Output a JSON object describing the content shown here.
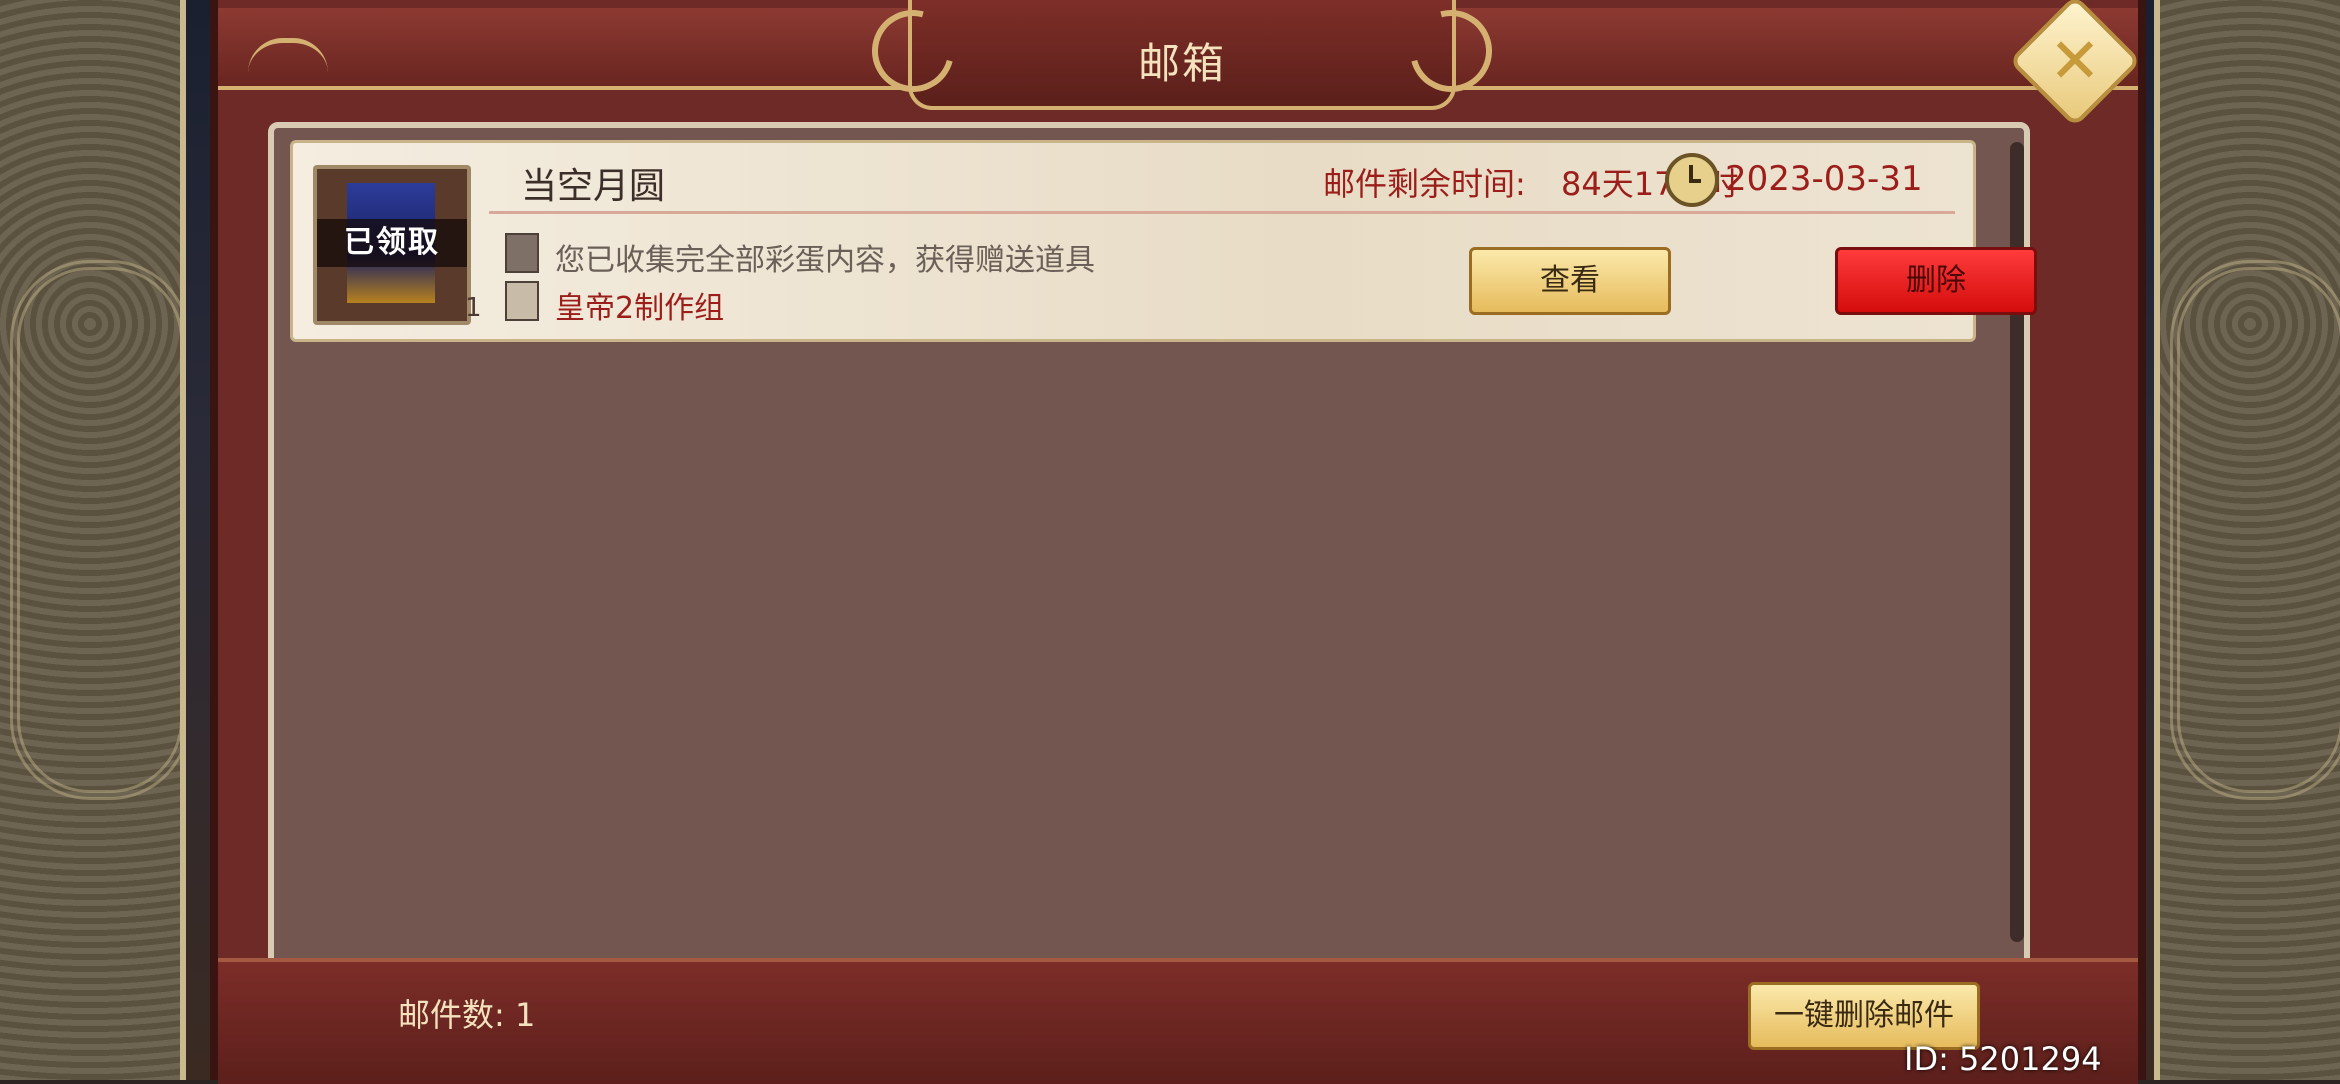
{
  "window": {
    "title": "邮箱"
  },
  "mail_items": [
    {
      "title": "当空月圆",
      "status_badge": "已领取",
      "quantity": "1",
      "expire_label": "邮件剩余时间:",
      "expire_value": "84天17小时",
      "date": "2023-03-31",
      "description": "您已收集完全部彩蛋内容，获得赠送道具",
      "sender": "皇帝2制作组",
      "view_label": "查看",
      "delete_label": "删除"
    }
  ],
  "footer": {
    "mail_count": "邮件数:  1",
    "delete_all_label": "一键删除邮件"
  },
  "user_id": "ID: 5201294",
  "icons": {
    "close": "close-icon",
    "clock": "clock-icon",
    "desc": "document-icon",
    "sender": "person-icon"
  },
  "colors": {
    "frame": "#6e2a26",
    "panel": "#735650",
    "accent_gold": "#d4b170",
    "delete_red": "#ff2020",
    "warning_text": "#9c1e1a"
  }
}
